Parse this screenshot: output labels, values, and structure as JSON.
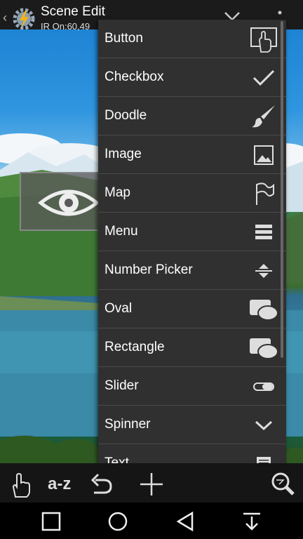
{
  "header": {
    "title": "Scene Edit",
    "subtitle": "IR On:60,49",
    "back_icon": "chevron-left-icon",
    "app_icon": "tasker-gear-icon",
    "collapse_icon": "chevron-down-icon",
    "overflow_icon": "overflow-dots-icon"
  },
  "menu": {
    "items": [
      {
        "label": "Button",
        "icon": "button-touch-icon"
      },
      {
        "label": "Checkbox",
        "icon": "checkmark-icon"
      },
      {
        "label": "Doodle",
        "icon": "paintbrush-icon"
      },
      {
        "label": "Image",
        "icon": "image-icon"
      },
      {
        "label": "Map",
        "icon": "flag-icon"
      },
      {
        "label": "Menu",
        "icon": "list-icon"
      },
      {
        "label": "Number Picker",
        "icon": "up-down-arrows-icon"
      },
      {
        "label": "Oval",
        "icon": "oval-icon"
      },
      {
        "label": "Rectangle",
        "icon": "rectangle-icon"
      },
      {
        "label": "Slider",
        "icon": "slider-icon"
      },
      {
        "label": "Spinner",
        "icon": "chevron-down-icon"
      },
      {
        "label": "Text",
        "icon": "text-icon"
      }
    ]
  },
  "scene": {
    "eye_element_icon": "eye-icon"
  },
  "toolbar": {
    "touch_icon": "hand-pointer-icon",
    "sort_label": "a-z",
    "undo_icon": "undo-icon",
    "add_icon": "plus-icon",
    "zoom_icon": "magnifier-icon"
  },
  "navbar": {
    "recents_icon": "square-icon",
    "home_icon": "circle-icon",
    "back_icon": "triangle-back-icon",
    "down_icon": "download-arrow-icon"
  },
  "colors": {
    "menu_bg": "#303030",
    "divider": "#4a4a4a",
    "topbar_bg": "#1b1b1b"
  }
}
